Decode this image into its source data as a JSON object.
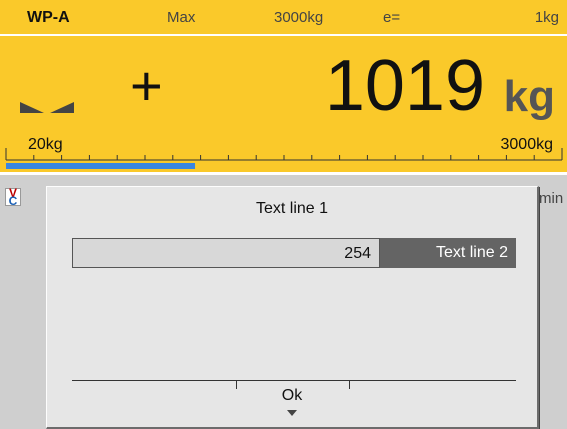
{
  "header": {
    "scale_name": "WP-A",
    "max_label": "Max",
    "max_value": "3000kg",
    "e_label": "e=",
    "e_value": "1kg"
  },
  "display": {
    "sign": "+",
    "weight": "1019",
    "unit": "kg",
    "range_min": "20kg",
    "range_max": "3000kg",
    "bargraph_fraction": 0.34,
    "center_of_zero_icon": "center-of-zero-icon"
  },
  "status": {
    "icon": "vc-icon",
    "icon_text_top": "V",
    "icon_text_bottom": "C",
    "partial_text": "min"
  },
  "dialog": {
    "title": "Text line 1",
    "input_value": "254",
    "label": "Text line 2",
    "ok_label": "Ok"
  },
  "colors": {
    "display_background": "#fac92a",
    "bargraph_fill": "#3a86e0",
    "dialog_label_background": "#646464"
  }
}
